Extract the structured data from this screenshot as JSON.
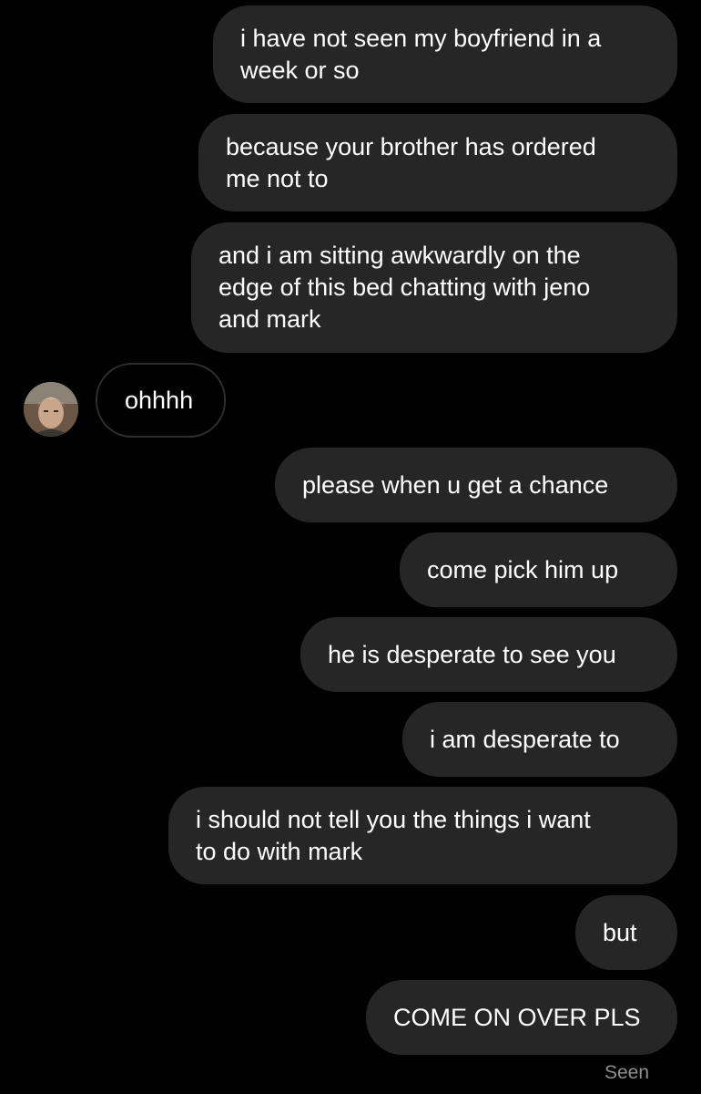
{
  "messages": [
    {
      "from": "me",
      "text": "i have not seen my boyfriend in a\nweek or so"
    },
    {
      "from": "me",
      "text": "because your brother has ordered\nme not to"
    },
    {
      "from": "me",
      "text": "and i am sitting awkwardly on the\nedge of this bed chatting with jeno\nand mark"
    },
    {
      "from": "them",
      "text": "ohhhh"
    },
    {
      "from": "me",
      "text": "please when u get a chance"
    },
    {
      "from": "me",
      "text": "come pick him up"
    },
    {
      "from": "me",
      "text": "he is desperate to see you"
    },
    {
      "from": "me",
      "text": "i am desperate to"
    },
    {
      "from": "me",
      "text": "i should not tell you the things i want\nto do with mark"
    },
    {
      "from": "me",
      "text": "but"
    },
    {
      "from": "me",
      "text": "COME ON OVER PLS"
    }
  ],
  "status": {
    "seen": "Seen"
  },
  "colors": {
    "background": "#000000",
    "sent_bubble": "#262626",
    "received_border": "#2e2e2e",
    "text": "#ffffff",
    "muted": "#8e8e8e"
  },
  "icons": {
    "avatar": "contact-avatar"
  }
}
